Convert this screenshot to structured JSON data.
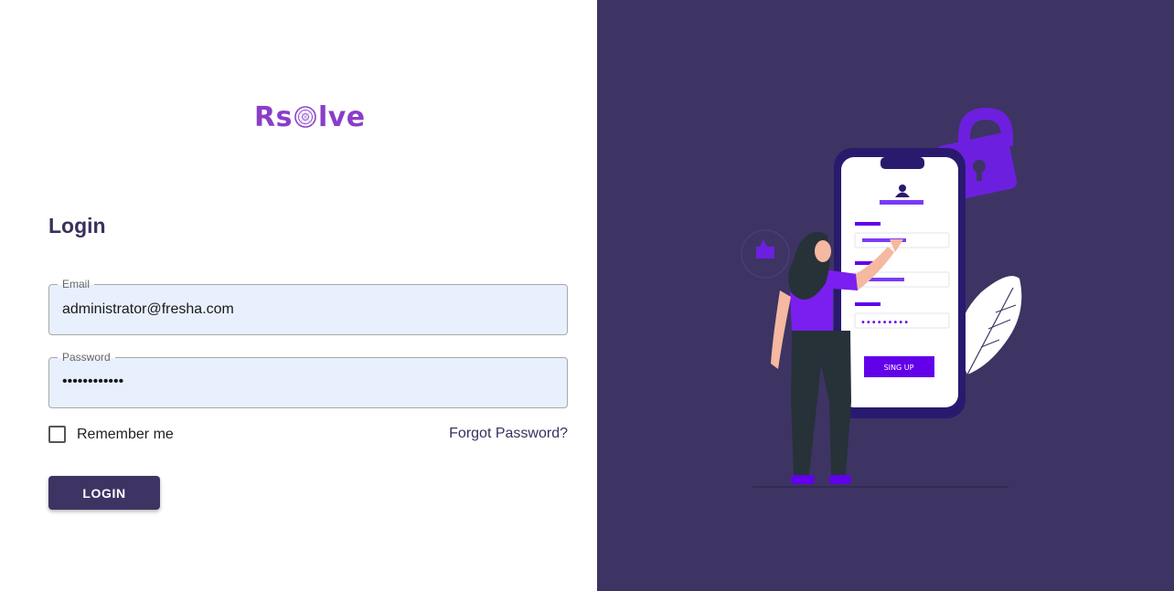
{
  "brand": {
    "name_prefix": "Rs",
    "name_suffix": "lve",
    "logo_alt": "Rsolve logo"
  },
  "login": {
    "title": "Login",
    "email": {
      "label": "Email",
      "value": "administrator@fresha.com"
    },
    "password": {
      "label": "Password",
      "masked_value": "••••••••••••"
    },
    "remember_me": {
      "label": "Remember me",
      "checked": false
    },
    "forgot_password": "Forgot Password?",
    "submit_label": "LOGIN"
  },
  "illustration": {
    "phone_button_label": "SING UP",
    "phone_password_mask": "•••••••••"
  },
  "colors": {
    "brand_purple": "#8a3ec9",
    "panel_bg": "#3d3463",
    "accent_violet": "#6200ea",
    "field_bg": "#e8f0fe",
    "text_dark": "#3b2f5e"
  }
}
